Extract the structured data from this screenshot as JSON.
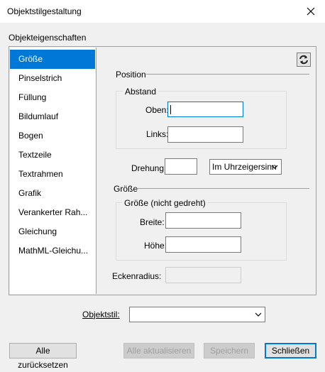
{
  "window": {
    "title": "Objektstilgestaltung"
  },
  "section_label": "Objekteigenschaften",
  "categories": [
    {
      "label": "Größe",
      "selected": true
    },
    {
      "label": "Pinselstrich"
    },
    {
      "label": "Füllung"
    },
    {
      "label": "Bildumlauf"
    },
    {
      "label": "Bogen"
    },
    {
      "label": "Textzeile"
    },
    {
      "label": "Textrahmen"
    },
    {
      "label": "Grafik"
    },
    {
      "label": "Verankerter Rah..."
    },
    {
      "label": "Gleichung"
    },
    {
      "label": "MathML-Gleichu..."
    }
  ],
  "position": {
    "heading": "Position",
    "abstand_group": "Abstand",
    "oben_label": "Oben:",
    "oben_value": "",
    "links_label": "Links:",
    "links_value": "",
    "drehung_label": "Drehung:",
    "drehung_value": "",
    "direction_value": "Im Uhrzeigersinn"
  },
  "size": {
    "heading": "Größe",
    "group": "Größe (nicht gedreht)",
    "breite_label": "Breite:",
    "breite_value": "",
    "hoehe_label": "Höhe:",
    "hoehe_value": ""
  },
  "eckenradius_label": "Eckenradius:",
  "objektstil": {
    "label": "Objektstil:",
    "value": ""
  },
  "buttons": {
    "reset": "Alle zurücksetzen",
    "update_all": "Alle aktualisieren",
    "save": "Speichern",
    "close": "Schließen"
  },
  "icons": {
    "refresh": "refresh-icon",
    "close": "close-icon",
    "dropdown": "chevron-down-icon"
  }
}
